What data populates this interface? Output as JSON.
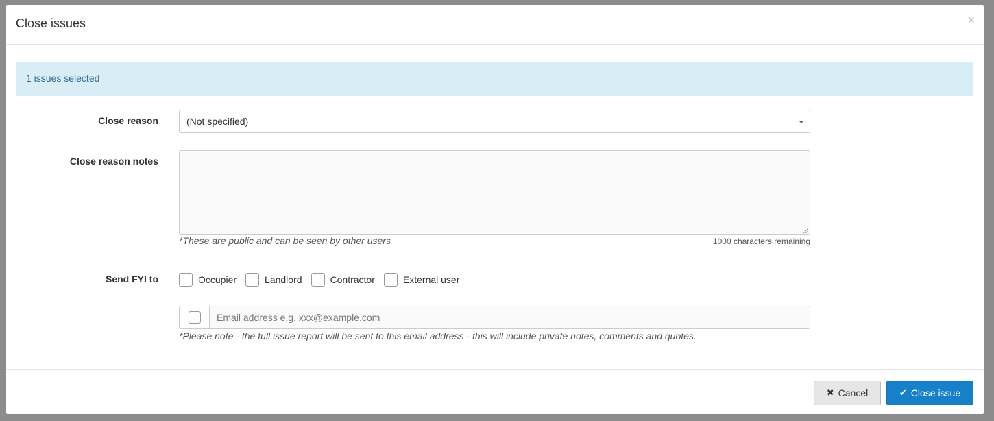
{
  "modal": {
    "title": "Close issues",
    "close_glyph": "×"
  },
  "alert": {
    "text": "1 issues selected"
  },
  "form": {
    "close_reason": {
      "label": "Close reason",
      "selected": "(Not specified)"
    },
    "close_reason_notes": {
      "label": "Close reason notes",
      "value": "",
      "help_text": "*These are public and can be seen by other users",
      "remaining": "1000 characters remaining"
    },
    "send_fyi": {
      "label": "Send FYI to",
      "options": [
        {
          "label": "Occupier",
          "checked": false
        },
        {
          "label": "Landlord",
          "checked": false
        },
        {
          "label": "Contractor",
          "checked": false
        },
        {
          "label": "External user",
          "checked": false
        }
      ],
      "email_placeholder": "Email address e.g. xxx@example.com",
      "email_checked": false,
      "note": "*Please note - the full issue report will be sent to this email address - this will include private notes, comments and quotes."
    }
  },
  "footer": {
    "cancel_label": "Cancel",
    "cancel_icon": "times-icon",
    "submit_label": "Close issue",
    "submit_icon": "check-icon"
  },
  "colors": {
    "alert_bg": "#d9edf7",
    "alert_text": "#31708f",
    "primary": "#1681c9"
  }
}
